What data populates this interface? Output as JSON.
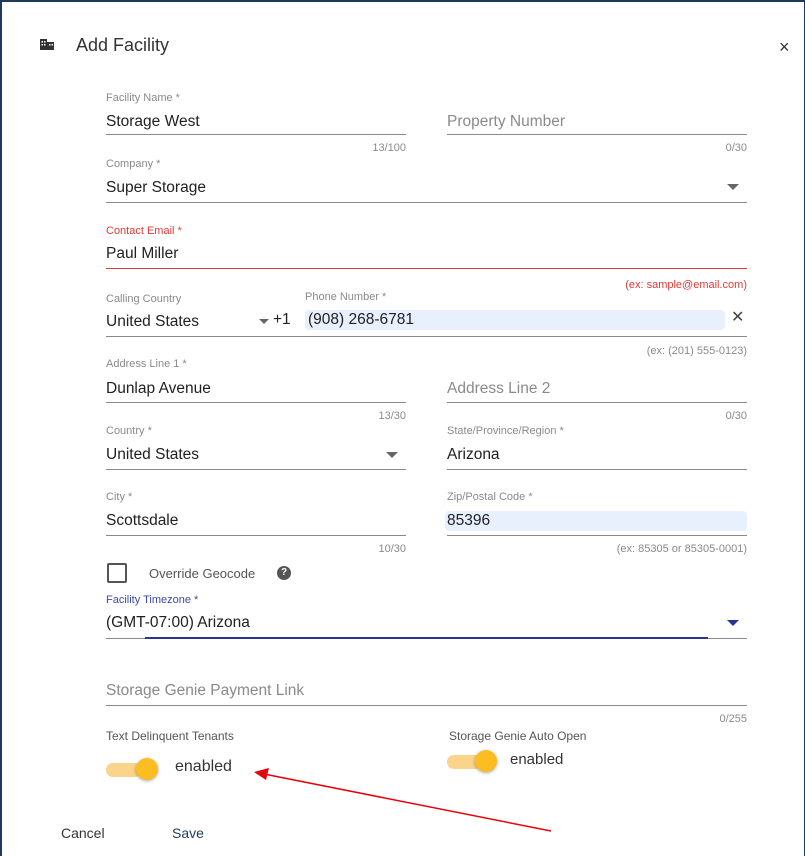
{
  "dialog": {
    "title": "Add Facility",
    "close_symbol": "×"
  },
  "facility_name": {
    "label": "Facility Name *",
    "value": "Storage West",
    "counter": "13/100"
  },
  "property_number": {
    "placeholder": "Property Number",
    "counter": "0/30"
  },
  "company": {
    "label": "Company *",
    "value": "Super Storage"
  },
  "contact_email": {
    "label": "Contact Email *",
    "value": "Paul Miller",
    "hint": "(ex: sample@email.com)"
  },
  "calling_country": {
    "label": "Calling Country",
    "value": "United States",
    "dial_code": "+1"
  },
  "phone_number": {
    "label": "Phone Number *",
    "value": "(908) 268-6781",
    "clear_symbol": "✕",
    "hint": "(ex: (201) 555-0123)"
  },
  "address_line_1": {
    "label": "Address Line 1 *",
    "value": "Dunlap Avenue",
    "counter": "13/30"
  },
  "address_line_2": {
    "placeholder": "Address Line 2",
    "counter": "0/30"
  },
  "country": {
    "label": "Country *",
    "value": "United States"
  },
  "state": {
    "label": "State/Province/Region *",
    "value": "Arizona"
  },
  "city": {
    "label": "City *",
    "value": "Scottsdale",
    "counter": "10/30"
  },
  "zip": {
    "label": "Zip/Postal Code *",
    "value": "85396",
    "hint": "(ex: 85305 or 85305-0001)"
  },
  "override_geocode": {
    "label": "Override Geocode",
    "checked": false,
    "help_symbol": "?"
  },
  "timezone": {
    "label": "Facility Timezone *",
    "value": "(GMT-07:00) Arizona"
  },
  "payment_link": {
    "placeholder": "Storage Genie Payment Link",
    "counter": "0/255"
  },
  "text_delinquent": {
    "label": "Text Delinquent Tenants",
    "state": "enabled",
    "on": true
  },
  "auto_open": {
    "label": "Storage Genie Auto Open",
    "state": "enabled",
    "on": true
  },
  "actions": {
    "cancel": "Cancel",
    "save": "Save"
  },
  "colors": {
    "accent": "#fbbd20",
    "error": "#e53935",
    "focus": "#283593",
    "annotation_arrow": "#e8000b"
  }
}
